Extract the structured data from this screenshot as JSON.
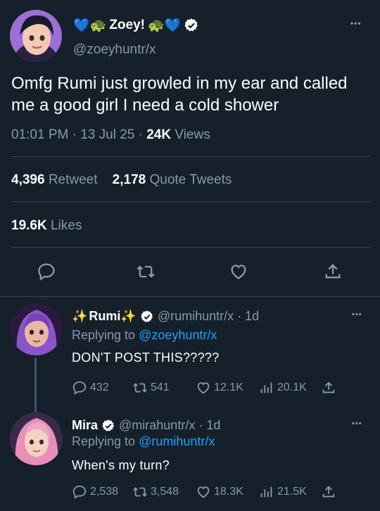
{
  "main_tweet": {
    "display_name_prefix": "💙🐢",
    "display_name": "Zoey!",
    "display_name_suffix": "🐢💙",
    "handle": "@zoeyhuntr/x",
    "text": "Omfg Rumi just growled in my ear and called me a good girl I need a cold shower",
    "time": "01:01 PM",
    "date": "13 Jul 25",
    "views_count": "24K",
    "views_label": "Views",
    "retweets_count": "4,396",
    "retweets_label": "Retweet",
    "quotes_count": "2,178",
    "quotes_label": "Quote Tweets",
    "likes_count": "19.6K",
    "likes_label": "Likes",
    "more": "•••"
  },
  "replies": [
    {
      "name_prefix": "✨",
      "name": "Rumi",
      "name_suffix": "✨",
      "handle": "@rumihuntr/x",
      "age": "1d",
      "replying_prefix": "Replying to",
      "replying_to": "@zoeyhuntr/x",
      "text": "DON'T POST THIS?????",
      "replies": "432",
      "retweets": "541",
      "likes": "12.1K",
      "views": "20.1K",
      "more": "•••"
    },
    {
      "name": "Mira",
      "handle": "@mirahuntr/x",
      "age": "1d",
      "replying_prefix": "Replying to",
      "replying_to": "@rumihuntr/x",
      "text": "When's my turn?",
      "replies": "2,538",
      "retweets": "3,548",
      "likes": "18.3K",
      "views": "21.5K",
      "more": "•••"
    }
  ],
  "colors": {
    "background": "#15202b",
    "accent": "#1da1f2",
    "secondary_text": "#8899a6",
    "divider": "#38444d"
  },
  "icons": [
    "reply-icon",
    "retweet-icon",
    "like-icon",
    "share-icon",
    "views-icon",
    "verified-icon",
    "more-icon"
  ]
}
